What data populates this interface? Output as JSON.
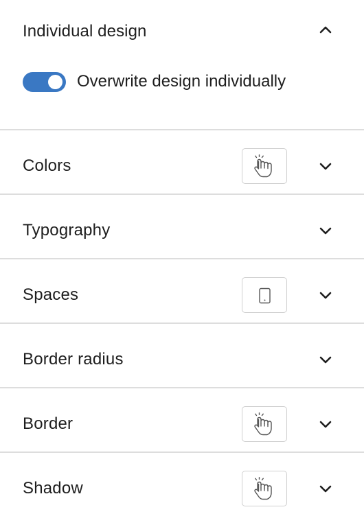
{
  "section": {
    "title": "Individual design",
    "toggle_label": "Overwrite design individually",
    "toggle_on": true,
    "icon": "chevron-up-icon"
  },
  "accent_color": "#3a78c3",
  "rows": [
    {
      "label": "Colors",
      "device_icon": "hover-hand-icon"
    },
    {
      "label": "Typography",
      "device_icon": null
    },
    {
      "label": "Spaces",
      "device_icon": "mobile-device-icon"
    },
    {
      "label": "Border radius",
      "device_icon": null
    },
    {
      "label": "Border",
      "device_icon": "hover-hand-icon"
    },
    {
      "label": "Shadow",
      "device_icon": "hover-hand-icon"
    }
  ]
}
